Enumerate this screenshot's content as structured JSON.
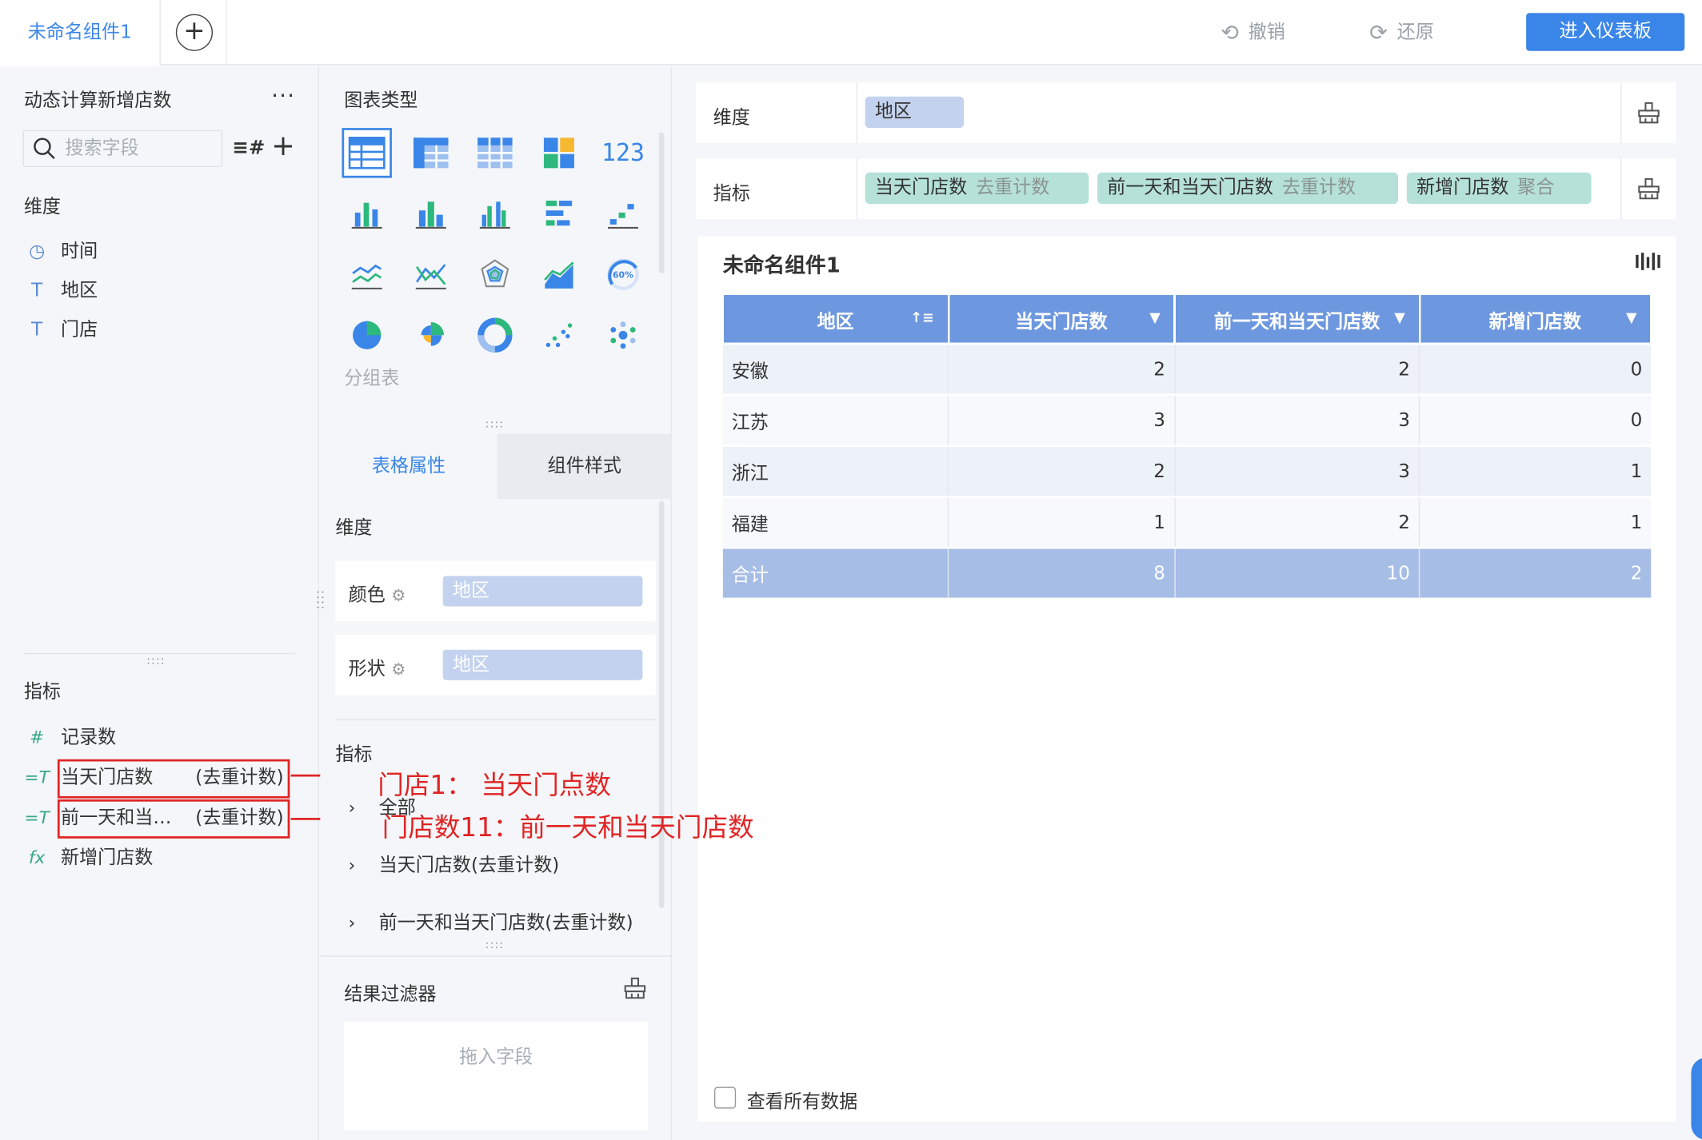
{
  "topbar": {
    "tab_label": "未命名组件1",
    "add_tab_glyph": "+",
    "undo_label": "撤销",
    "redo_label": "还原",
    "enter_dashboard_label": "进入仪表板"
  },
  "left": {
    "dataset_title": "动态计算新增店数",
    "more_glyph": "···",
    "search_placeholder": "搜索字段",
    "field_type_glyph": "≡#",
    "add_field_glyph": "+",
    "dimension_label": "维度",
    "dimensions": [
      {
        "icon": "clock-icon",
        "glyph": "◷",
        "label": "时间"
      },
      {
        "icon": "text-type-icon",
        "glyph": "T",
        "label": "地区"
      },
      {
        "icon": "text-type-icon",
        "glyph": "T",
        "label": "门店"
      }
    ],
    "metric_label": "指标",
    "metrics": [
      {
        "icon": "number-icon",
        "glyph": "#",
        "label": "记录数",
        "agg": ""
      },
      {
        "icon": "text-metric-icon",
        "glyph": "=T",
        "label": "当天门店数",
        "agg": "(去重计数)"
      },
      {
        "icon": "text-metric-icon",
        "glyph": "=T",
        "label": "前一天和当…",
        "agg": "(去重计数)"
      },
      {
        "icon": "formula-icon",
        "glyph": "fx",
        "label": "新增门店数",
        "agg": ""
      }
    ],
    "grip_glyph": "::::",
    "annotations": [
      "门店1： 当天门点数",
      "门店数11：前一天和当天门店数"
    ]
  },
  "middle": {
    "chart_type_label": "图表类型",
    "group_table_label": "分组表",
    "grip_glyph": "::::",
    "tabs": [
      {
        "label": "表格属性"
      },
      {
        "label": "组件样式"
      }
    ],
    "dimension_label": "维度",
    "color_label": "颜色",
    "shape_label": "形状",
    "gear_glyph": "⚙",
    "color_field": "地区",
    "shape_field": "地区",
    "metric_label": "指标",
    "tree_items": [
      {
        "chevron": "›",
        "label": "全部"
      },
      {
        "chevron": "›",
        "label": "当天门店数(去重计数)"
      },
      {
        "chevron": "›",
        "label": "前一天和当天门店数(去重计数)"
      }
    ],
    "filter_label": "结果过滤器",
    "drop_zone_label": "拖入字段"
  },
  "right": {
    "dimension_bar_label": "维度",
    "dimension_chip": "地区",
    "metric_bar_label": "指标",
    "metric_chips": [
      {
        "label": "当天门店数",
        "agg": "去重计数"
      },
      {
        "label": "前一天和当天门店数",
        "agg": "去重计数"
      },
      {
        "label": "新增门店数",
        "agg": "聚合"
      }
    ],
    "widget_title": "未命名组件1",
    "table": {
      "sort_glyph": "↑≡",
      "dropdown_glyph": "▼",
      "headers": [
        "地区",
        "当天门店数",
        "前一天和当天门店数",
        "新增门店数"
      ],
      "rows": [
        [
          "安徽",
          "2",
          "2",
          "0"
        ],
        [
          "江苏",
          "3",
          "3",
          "0"
        ],
        [
          "浙江",
          "2",
          "3",
          "1"
        ],
        [
          "福建",
          "1",
          "2",
          "1"
        ]
      ],
      "total": [
        "合计",
        "8",
        "10",
        "2"
      ]
    },
    "view_all_label": "查看所有数据"
  },
  "colors": {
    "accent": "#3a86e8",
    "header_bg": "#6d97de",
    "total_bg": "#a6bde6",
    "dim_chip": "#c3d2ee",
    "metric_chip": "#b5e1d8",
    "annotation_red": "#e02424"
  }
}
